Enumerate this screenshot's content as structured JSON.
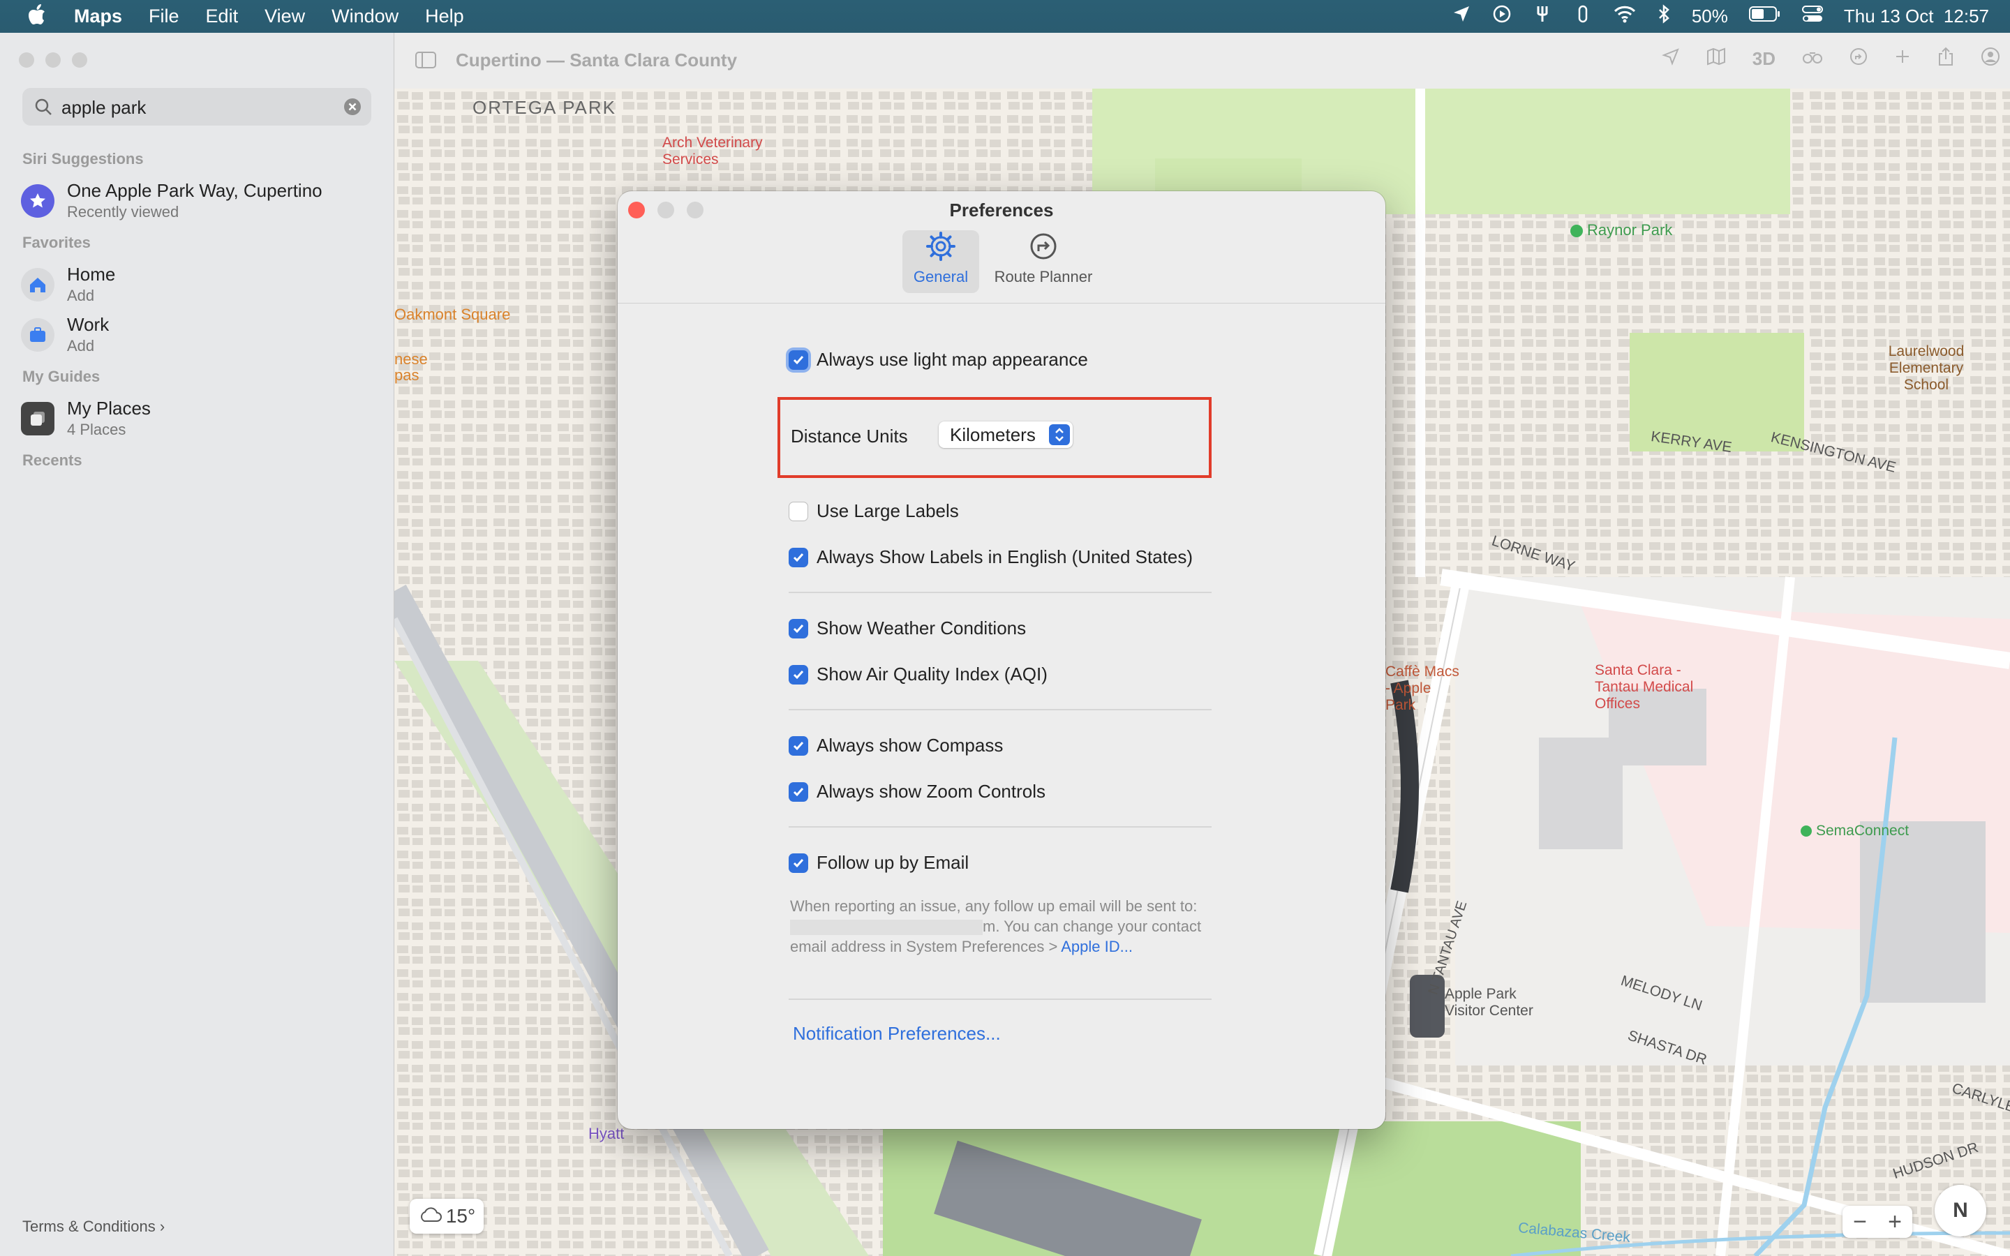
{
  "menubar": {
    "app_name": "Maps",
    "items": [
      "File",
      "Edit",
      "View",
      "Window",
      "Help"
    ],
    "battery": "50%",
    "datetime": "Thu 13 Oct  12:57"
  },
  "sidebar": {
    "search_value": "apple park",
    "siri_title": "Siri Suggestions",
    "siri_item": {
      "title": "One Apple Park Way, Cupertino",
      "subtitle": "Recently viewed"
    },
    "favorites_title": "Favorites",
    "favorites": [
      {
        "title": "Home",
        "subtitle": "Add"
      },
      {
        "title": "Work",
        "subtitle": "Add"
      }
    ],
    "guides_title": "My Guides",
    "guide": {
      "title": "My Places",
      "subtitle": "4 Places"
    },
    "recents_title": "Recents",
    "terms": "Terms & Conditions"
  },
  "toolbar": {
    "title": "Cupertino — Santa Clara County",
    "mode_3d": "3D"
  },
  "map": {
    "labels": [
      "ORTEGA PARK",
      "Oakmont Square",
      "Raynor Park",
      "Laurelwood Elementary School",
      "Santa Clara - Tantau Medical Offices",
      "SemaConnect",
      "Apple Park Visitor Center",
      "Caffè Macs - Apple Park",
      "Arch Veterinary Services",
      "Hyatt",
      "KERRY AVE",
      "KENSINGTON AVE",
      "LORNE WAY",
      "MELODY LN",
      "SHASTA DR",
      "HUDSON DR",
      "CARLYLE",
      "N TANTAU AVE",
      "Calabazas Creek",
      "nese",
      "pas"
    ],
    "weather": "15°"
  },
  "dialog": {
    "title": "Preferences",
    "tabs": [
      {
        "label": "General",
        "icon": "gear-icon",
        "active": true
      },
      {
        "label": "Route Planner",
        "icon": "route-icon",
        "active": false
      }
    ],
    "light_map": {
      "label": "Always use light map appearance",
      "checked": true
    },
    "distance_units": {
      "label": "Distance Units",
      "value": "Kilometers"
    },
    "large_labels": {
      "label": "Use Large Labels",
      "checked": false
    },
    "english_labels": {
      "label": "Always Show Labels in English (United States)",
      "checked": true
    },
    "weather": {
      "label": "Show Weather Conditions",
      "checked": true
    },
    "aqi": {
      "label": "Show Air Quality Index (AQI)",
      "checked": true
    },
    "compass": {
      "label": "Always show Compass",
      "checked": true
    },
    "zoom_controls": {
      "label": "Always show Zoom Controls",
      "checked": true
    },
    "follow_up": {
      "label": "Follow up by Email",
      "checked": true
    },
    "note_1": "When reporting an issue, any follow up email will be sent to: ",
    "note_2": "m. You can change your contact email address in System Preferences > ",
    "note_link": "Apple ID...",
    "notification_link": "Notification Preferences..."
  },
  "colors": {
    "accent": "#2f6fdc",
    "highlight": "#e13c2a",
    "menubar": "#2a5b70"
  }
}
